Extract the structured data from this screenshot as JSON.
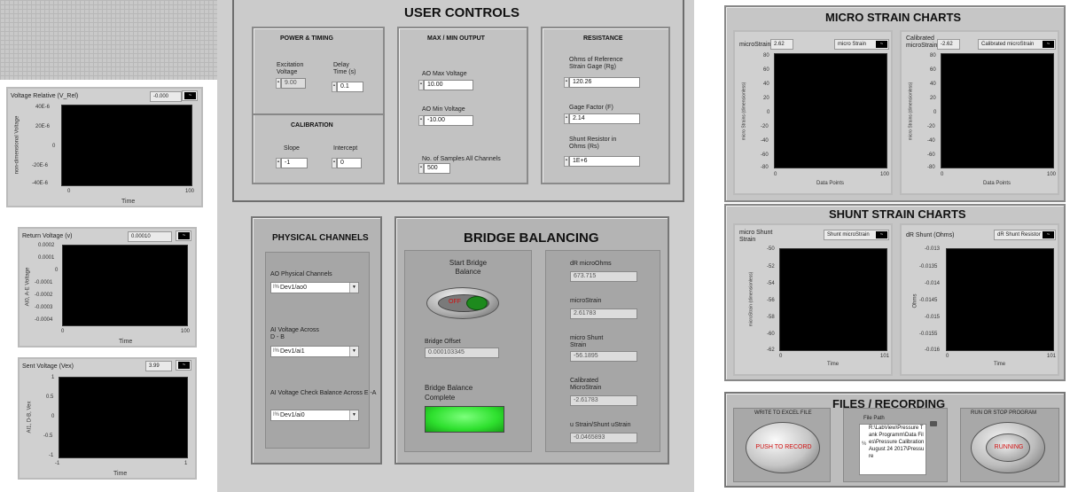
{
  "user_controls": {
    "title": "USER CONTROLS",
    "power_timing": {
      "title": "POWER & TIMING",
      "excitation_label": "Excitation Voltage",
      "excitation_value": "9.00",
      "delay_label": "Delay Time (s)",
      "delay_value": "0.1"
    },
    "calibration": {
      "title": "CALIBRATION",
      "slope_label": "Slope",
      "slope_value": "-1",
      "intercept_label": "Intercept",
      "intercept_value": "0"
    },
    "max_min_output": {
      "title": "MAX / MIN OUTPUT",
      "ao_max_label": "AO Max Voltage",
      "ao_max_value": "10.00",
      "ao_min_label": "AO Min Voltage",
      "ao_min_value": "-10.00",
      "samples_label": "No. of Samples All Channels",
      "samples_value": "500"
    },
    "resistance": {
      "title": "RESISTANCE",
      "ohms_label": "Ohms of Reference Strain Gage (Rg)",
      "ohms_value": "120.26",
      "gage_label": "Gage Factor (F)",
      "gage_value": "2.14",
      "shunt_label": "Shunt Resistor in Ohms (Rs)",
      "shunt_value": "1E+6"
    }
  },
  "physical_channels": {
    "title": "PHYSICAL CHANNELS",
    "ao_label": "AO Physical Channels",
    "ao_value": "Dev1/ao0",
    "ai_db_label": "AI Voltage Across D - B",
    "ai_db_value": "Dev1/ai1",
    "ai_ea_label": "AI Voltage Check Balance Across E -A",
    "ai_ea_value": "Dev1/ai0",
    "io_key": "I%"
  },
  "bridge_balancing": {
    "title": "BRIDGE BALANCING",
    "start_label": "Start Bridge Balance",
    "start_state": "OFF",
    "offset_label": "Bridge Offset",
    "offset_value": "0.000103345",
    "complete_label": "Bridge Balance Complete",
    "dr_label": "dR microOhms",
    "dr_value": "673.715",
    "ms_label": "microStrain",
    "ms_value": "2.61783",
    "shunt_label": "micro Shunt Strain",
    "shunt_value": "-56.1895",
    "cal_label": "Calibrated MicroStrain",
    "cal_value": "-2.61783",
    "ratio_label": "u Strain/Shunt uStrain",
    "ratio_value": "-0.0465893"
  },
  "left_charts": [
    {
      "title": "Voltage Relative (V_Rel)",
      "readout": "-0.000",
      "ylabel": "non-dimensional Voltage",
      "xlabel": "Time",
      "yticks": [
        "40E-6",
        "20E-6",
        "0",
        "-20E-6",
        "-40E-6"
      ],
      "xticks": [
        "0",
        "100"
      ]
    },
    {
      "title": "Return Voltage (v)",
      "readout": "0.00010",
      "ylabel": "AI0, A-E Voltage",
      "xlabel": "Time",
      "yticks": [
        "0.0002",
        "0.0001",
        "0",
        "-0.0001",
        "-0.0002",
        "-0.0003",
        "-0.0004"
      ],
      "xticks": [
        "0",
        "100"
      ]
    },
    {
      "title": "Sent Voltage (Vex)",
      "readout": "3.99",
      "ylabel": "AI1, D-B, Vex",
      "xlabel": "Time",
      "yticks": [
        "1",
        "0.5",
        "0",
        "-0.5",
        "-1"
      ],
      "xticks": [
        "-1",
        "1"
      ]
    }
  ],
  "micro_strain_charts": {
    "title": "MICRO STRAIN CHARTS",
    "charts": [
      {
        "readout_label": "microStrain",
        "readout": "2.62",
        "legend": "micro Strain",
        "ylabel": "micro Strains (dimensionless)",
        "xlabel": "Data Points",
        "yticks": [
          "80",
          "60",
          "40",
          "20",
          "0",
          "-20",
          "-40",
          "-60",
          "-80"
        ],
        "xticks": [
          "0",
          "100"
        ]
      },
      {
        "readout_label": "Calibrated microStrain",
        "readout": "-2.62",
        "legend": "Calibrated microStrain",
        "ylabel": "micro Strains (dimensionless)",
        "xlabel": "Data Points",
        "yticks": [
          "80",
          "60",
          "40",
          "20",
          "0",
          "-20",
          "-40",
          "-60",
          "-80"
        ],
        "xticks": [
          "0",
          "100"
        ]
      }
    ]
  },
  "shunt_strain_charts": {
    "title": "SHUNT STRAIN CHARTS",
    "charts": [
      {
        "readout_label": "micro Shunt Strain",
        "legend": "Shunt microStrain",
        "ylabel": "microStrain (dimensionless)",
        "xlabel": "Time",
        "yticks": [
          "-50",
          "-52",
          "-54",
          "-56",
          "-58",
          "-60",
          "-62"
        ],
        "xticks": [
          "0",
          "101"
        ]
      },
      {
        "readout_label": "dR Shunt (Ohms)",
        "legend": "dR Shunt Resistor",
        "ylabel": "Ohms",
        "xlabel": "Time",
        "yticks": [
          "-0.013",
          "-0.0135",
          "-0.014",
          "-0.0145",
          "-0.015",
          "-0.0155",
          "-0.016"
        ],
        "xticks": [
          "0",
          "101"
        ]
      }
    ]
  },
  "files_recording": {
    "title": "FILES / RECORDING",
    "write_label": "WRITE TO EXCEL FILE",
    "write_button": "PUSH TO RECORD",
    "path_label": "File Path",
    "path_value": "R:\\LabView\\Pressure Tank Programm\\Data Files\\Pressure Calibration August 24 2017\\Pressure",
    "run_label": "RUN OR STOP PROGRAM",
    "run_button": "RUNNING"
  },
  "colors": {
    "led_on": "#2ee02e",
    "button_text_red": "#d01010",
    "toggle_green": "#1d8a1d"
  }
}
